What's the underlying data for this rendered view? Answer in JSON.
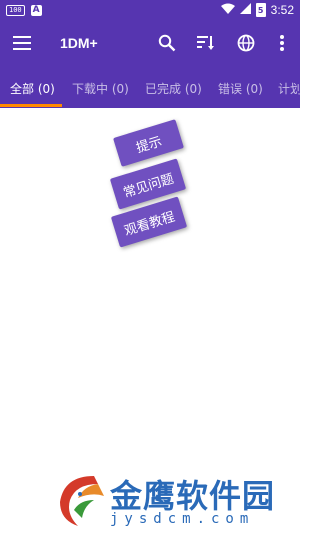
{
  "status_bar": {
    "badge": "100",
    "a_icon": "A",
    "battery_level": "5",
    "time": "3:52",
    "icons": [
      "wifi-icon",
      "signal-icon",
      "battery-icon"
    ]
  },
  "app_bar": {
    "title": "1DM+",
    "icons": [
      "menu-icon",
      "search-icon",
      "sort-icon",
      "globe-icon",
      "more-vert-icon"
    ]
  },
  "tabs": [
    {
      "label": "全部 (0)",
      "active": true
    },
    {
      "label": "下载中 (0)",
      "active": false
    },
    {
      "label": "已完成 (0)",
      "active": false
    },
    {
      "label": "错误 (0)",
      "active": false
    },
    {
      "label": "计划",
      "active": false
    }
  ],
  "floating_buttons": [
    {
      "label": "提示"
    },
    {
      "label": "常见问题"
    },
    {
      "label": "观看教程"
    }
  ],
  "watermark": {
    "name": "金鹰软件园",
    "url": "jysdcm.com"
  },
  "colors": {
    "primary": "#5635b0",
    "button": "#7050c0",
    "indicator": "#ff8a00",
    "watermark": "#2a6ab8"
  }
}
